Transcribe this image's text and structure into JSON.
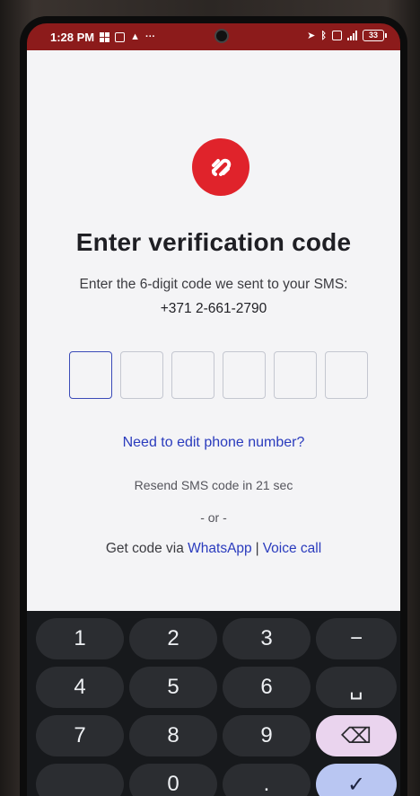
{
  "status_bar": {
    "time": "1:28 PM",
    "battery": "33",
    "icons": [
      "grid-icon",
      "notification-icon",
      "warning-icon",
      "more-icon",
      "location-icon",
      "bluetooth-icon",
      "volte-icon",
      "signal-icon",
      "battery-icon"
    ],
    "background": "#8c1b1b"
  },
  "app": {
    "logo_icon": "authy-logo-icon",
    "brand_color": "#e0232b",
    "title": "Enter verification code",
    "subtitle": "Enter the 6-digit code we sent to your SMS:",
    "phone_number": "+371 2-661-2790",
    "code_length": 6,
    "code_digits": [
      "",
      "",
      "",
      "",
      "",
      ""
    ],
    "edit_link": "Need to edit phone number?",
    "resend_text": "Resend SMS code in 21 sec",
    "or_text": "- or -",
    "alt_prefix": "Get code via",
    "whatsapp_link": "WhatsApp",
    "separator": "|",
    "voice_link": "Voice call",
    "link_color": "#2a3bbd"
  },
  "keyboard": {
    "keys": [
      "1",
      "2",
      "3",
      "−",
      "4",
      "5",
      "6",
      "␣",
      "7",
      "8",
      "9",
      "⌫",
      "",
      "0",
      ".",
      "✓"
    ],
    "icons": {
      "backspace": "backspace-icon",
      "space": "space-icon",
      "confirm": "check-icon"
    }
  }
}
